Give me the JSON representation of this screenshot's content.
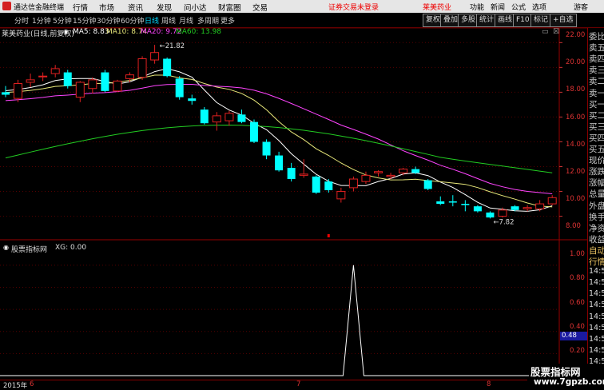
{
  "window": {
    "app_name": "通达信金融终端",
    "warning": "证券交易未登录",
    "stock": "莱美药业"
  },
  "top_menu": [
    "行情",
    "市场",
    "资讯",
    "发现",
    "问小达",
    "财富圈",
    "交易"
  ],
  "right_menu": [
    "功能",
    "新闻",
    "公式",
    "选项",
    "游客"
  ],
  "periods": [
    "分时",
    "1分钟",
    "5分钟",
    "15分钟",
    "30分钟",
    "60分钟",
    "日线",
    "周线",
    "月线",
    "多周期",
    "更多"
  ],
  "active_period": "日线",
  "tools": [
    "复权",
    "叠加",
    "多股",
    "统计",
    "画线",
    "F10",
    "标记",
    "+自选"
  ],
  "ma_info": {
    "name": "莱美药业(日线,前复权)",
    "ma5": "MA5: 8.83",
    "ma10": "MA10: 8.74",
    "ma20": "MA20: 9.72",
    "ma60": "MA60: 13.98"
  },
  "indicator_info": {
    "name": "股票指标网",
    "xg": "XG: 0.00"
  },
  "price_axis": [
    "22.00",
    "20.00",
    "18.00",
    "16.00",
    "14.00",
    "12.00",
    "10.00",
    "8.00"
  ],
  "indicator_axis": [
    "1.00",
    "0.80",
    "0.60",
    "0.40",
    "0.20"
  ],
  "indicator_highlight": "0.48",
  "annotations": {
    "high": "21.82",
    "low": "7.82"
  },
  "dates": [
    "2015年",
    "6",
    "7",
    "8"
  ],
  "right_panel": [
    "委比",
    "卖五",
    "卖四",
    "卖三",
    "卖二",
    "卖一",
    "买一",
    "买二",
    "买三",
    "买四",
    "买五",
    "现价",
    "涨跌",
    "涨幅",
    "总量",
    "外盘",
    "换手",
    "净资",
    "收益",
    "自动",
    "行情",
    "14:56",
    "14:56",
    "14:56",
    "14:56",
    "14:56",
    "14:56",
    "14:56",
    "14:56",
    "14:56",
    "14:56"
  ],
  "watermark": {
    "line1": "股票指标网",
    "line2": "www.7gpzb.com"
  },
  "colors": {
    "up": "#e02020",
    "down": "#00ffff",
    "ma5": "#ffffff",
    "ma10": "#e8e87a",
    "ma20": "#ff44ff",
    "ma60": "#22cc22"
  },
  "chart_data": {
    "type": "candlestick",
    "price_range": [
      7.2,
      22.6
    ],
    "candles": [
      {
        "o": 18.0,
        "h": 18.5,
        "l": 17.6,
        "c": 17.8
      },
      {
        "o": 17.5,
        "h": 19.0,
        "l": 17.2,
        "c": 18.7
      },
      {
        "o": 18.8,
        "h": 19.5,
        "l": 18.4,
        "c": 19.0
      },
      {
        "o": 19.3,
        "h": 19.6,
        "l": 18.9,
        "c": 19.3
      },
      {
        "o": 19.5,
        "h": 20.2,
        "l": 19.2,
        "c": 19.9
      },
      {
        "o": 19.6,
        "h": 19.8,
        "l": 18.3,
        "c": 18.5
      },
      {
        "o": 17.6,
        "h": 18.9,
        "l": 17.2,
        "c": 18.8
      },
      {
        "o": 18.3,
        "h": 19.2,
        "l": 17.9,
        "c": 19.0
      },
      {
        "o": 19.6,
        "h": 19.8,
        "l": 18.0,
        "c": 18.1
      },
      {
        "o": 18.1,
        "h": 19.0,
        "l": 18.0,
        "c": 18.9
      },
      {
        "o": 19.1,
        "h": 19.6,
        "l": 18.8,
        "c": 19.4
      },
      {
        "o": 19.2,
        "h": 20.9,
        "l": 19.0,
        "c": 20.7
      },
      {
        "o": 20.6,
        "h": 21.82,
        "l": 20.3,
        "c": 21.2
      },
      {
        "o": 20.7,
        "h": 20.8,
        "l": 19.2,
        "c": 19.3
      },
      {
        "o": 19.1,
        "h": 19.3,
        "l": 17.4,
        "c": 17.6
      },
      {
        "o": 17.5,
        "h": 17.8,
        "l": 17.0,
        "c": 17.3
      },
      {
        "o": 16.6,
        "h": 16.8,
        "l": 15.4,
        "c": 15.5
      },
      {
        "o": 15.6,
        "h": 16.4,
        "l": 14.9,
        "c": 16.1
      },
      {
        "o": 15.7,
        "h": 16.5,
        "l": 15.3,
        "c": 16.3
      },
      {
        "o": 16.2,
        "h": 16.6,
        "l": 15.5,
        "c": 15.6
      },
      {
        "o": 15.6,
        "h": 15.8,
        "l": 13.9,
        "c": 14.0
      },
      {
        "o": 14.0,
        "h": 14.2,
        "l": 12.6,
        "c": 12.9
      },
      {
        "o": 12.9,
        "h": 13.2,
        "l": 11.6,
        "c": 11.7
      },
      {
        "o": 11.9,
        "h": 12.3,
        "l": 10.8,
        "c": 11.0
      },
      {
        "o": 11.3,
        "h": 12.6,
        "l": 11.1,
        "c": 11.4
      },
      {
        "o": 11.2,
        "h": 11.3,
        "l": 9.8,
        "c": 9.9
      },
      {
        "o": 10.8,
        "h": 11.0,
        "l": 9.9,
        "c": 10.1
      },
      {
        "o": 9.4,
        "h": 10.3,
        "l": 9.1,
        "c": 10.0
      },
      {
        "o": 10.3,
        "h": 11.2,
        "l": 10.0,
        "c": 11.0
      },
      {
        "o": 10.8,
        "h": 11.6,
        "l": 10.6,
        "c": 11.3
      },
      {
        "o": 11.5,
        "h": 11.7,
        "l": 11.2,
        "c": 11.6
      },
      {
        "o": 11.2,
        "h": 11.5,
        "l": 11.0,
        "c": 11.3
      },
      {
        "o": 11.5,
        "h": 11.9,
        "l": 11.3,
        "c": 11.8
      },
      {
        "o": 11.8,
        "h": 12.0,
        "l": 11.4,
        "c": 11.5
      },
      {
        "o": 10.9,
        "h": 11.0,
        "l": 10.1,
        "c": 10.2
      },
      {
        "o": 9.2,
        "h": 9.6,
        "l": 8.9,
        "c": 9.0
      },
      {
        "o": 9.2,
        "h": 9.7,
        "l": 8.8,
        "c": 9.1
      },
      {
        "o": 9.0,
        "h": 9.3,
        "l": 8.4,
        "c": 8.9
      },
      {
        "o": 8.8,
        "h": 8.9,
        "l": 8.3,
        "c": 8.4
      },
      {
        "o": 8.3,
        "h": 8.4,
        "l": 7.82,
        "c": 7.9
      },
      {
        "o": 8.0,
        "h": 8.7,
        "l": 7.9,
        "c": 8.5
      },
      {
        "o": 8.8,
        "h": 8.9,
        "l": 8.4,
        "c": 8.5
      },
      {
        "o": 8.6,
        "h": 8.9,
        "l": 8.4,
        "c": 8.7
      },
      {
        "o": 8.6,
        "h": 9.3,
        "l": 8.4,
        "c": 9.0
      },
      {
        "o": 9.0,
        "h": 9.7,
        "l": 8.9,
        "c": 9.5
      }
    ],
    "xg_signal_index": 28,
    "indicator_range": [
      0,
      1.1
    ]
  }
}
